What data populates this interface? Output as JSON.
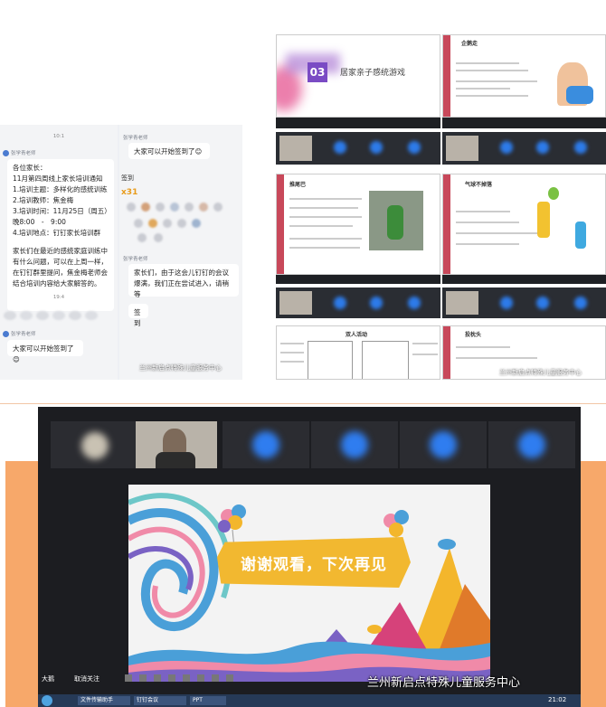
{
  "chat": {
    "left_time": "10:1",
    "sender": "张学青老师",
    "notice_lines": [
      "各位家长：",
      "11月第四周线上家长培训通知",
      "1.培训主题：多样化的感统训练",
      "2.培训教师：焦金梅",
      "3.培训时间：11月25日（周五）",
      "晚8:00　-　9:00",
      "4.培训地点：钉钉家长培训群"
    ],
    "notice_extra": "家长们在最近的感统家庭训练中有什么问题，可以在上周一样，在钉钉群里提问，焦金梅老师会结合培训内容给大家解答的。",
    "mid_time": "19:4",
    "sender2": "张学青老师",
    "checkin_prompt": "大家可以开始签到了😊",
    "right_sender": "张学青老师",
    "right_checkin": "大家可以开始签到了😊",
    "sign_label": "签到",
    "x31": "x31",
    "right_sender2": "张学青老师",
    "right_msg2": "家长们，由于这会儿钉钉的会议爆满，我们正在尝试进入，请稍等",
    "sign_label2": "签到",
    "watermark": "兰州新启点特殊儿童服务中心"
  },
  "slides": {
    "game_number": "03",
    "game_title": "居家亲子感统游戏",
    "s2_title": "企鹅走",
    "s3_title": "推尾巴",
    "s4_title": "气球不掉落",
    "s5_title": "双人活动",
    "s6_title": "投枕头",
    "watermark": "兰州新启点特殊儿童服务中心"
  },
  "meeting": {
    "banner": "谢谢观看，下次再见",
    "ctrl_left": "大鹅",
    "ctrl_right": "取消关注",
    "watermark": "兰州新启点特殊儿童服务中心",
    "taskbar": [
      "文件传输助手",
      "钉钉会议",
      "PPT"
    ],
    "clock": "21:02"
  },
  "colors": {
    "orange": "#f7a86a",
    "meeting_bg": "#1c1d21",
    "accent_blue": "#2f7df0",
    "banner": "#f2b830"
  }
}
